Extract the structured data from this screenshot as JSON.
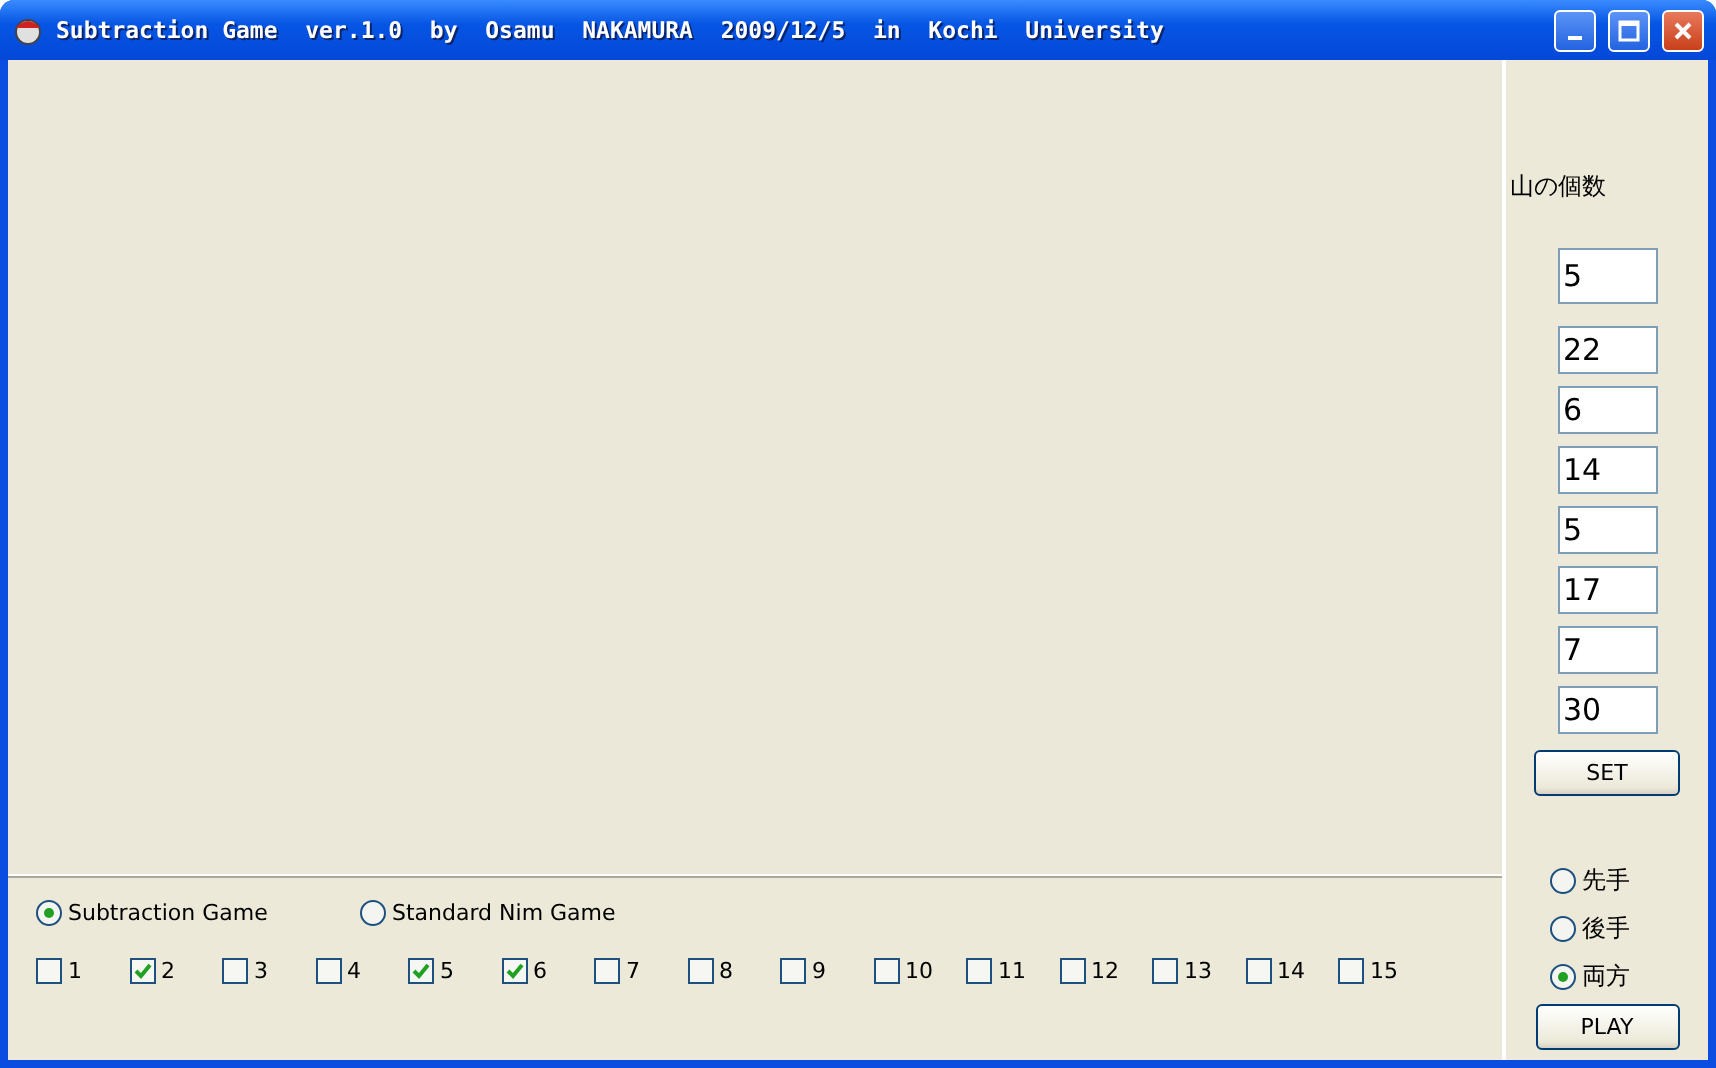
{
  "window": {
    "title": "Subtraction Game  ver.1.0  by  Osamu  NAKAMURA  2009/12/5  in  Kochi  University"
  },
  "piles": {
    "label": "山の個数",
    "values": [
      "5",
      "22",
      "6",
      "14",
      "5",
      "17",
      "7",
      "30"
    ],
    "button": "SET"
  },
  "turn_options": [
    {
      "label": "先手",
      "selected": false
    },
    {
      "label": "後手",
      "selected": false
    },
    {
      "label": "両方",
      "selected": true
    }
  ],
  "play_button": "PLAY",
  "game_modes": [
    {
      "label": "Subtraction Game",
      "selected": true
    },
    {
      "label": "Standard Nim Game",
      "selected": false
    }
  ],
  "moves": [
    {
      "label": "1",
      "checked": false
    },
    {
      "label": "2",
      "checked": true
    },
    {
      "label": "3",
      "checked": false
    },
    {
      "label": "4",
      "checked": false
    },
    {
      "label": "5",
      "checked": true
    },
    {
      "label": "6",
      "checked": true
    },
    {
      "label": "7",
      "checked": false
    },
    {
      "label": "8",
      "checked": false
    },
    {
      "label": "9",
      "checked": false
    },
    {
      "label": "10",
      "checked": false
    },
    {
      "label": "11",
      "checked": false
    },
    {
      "label": "12",
      "checked": false
    },
    {
      "label": "13",
      "checked": false
    },
    {
      "label": "14",
      "checked": false
    },
    {
      "label": "15",
      "checked": false
    }
  ]
}
